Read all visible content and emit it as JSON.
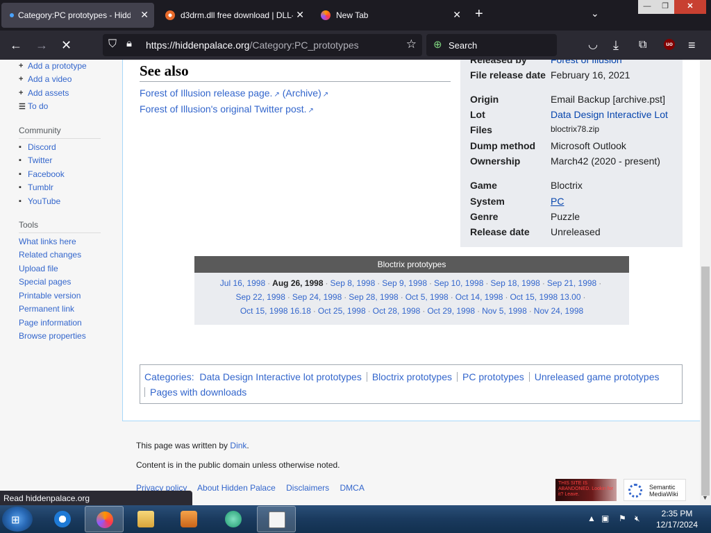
{
  "browser": {
    "tabs": [
      {
        "title": "Category:PC prototypes - Hidd",
        "active": true
      },
      {
        "title": "d3drm.dll free download | DLL-",
        "active": false
      },
      {
        "title": "New Tab",
        "active": false
      }
    ],
    "url_host": "https://hiddenpalace.org",
    "url_path": "/Category:PC_prototypes",
    "search_placeholder": "Search",
    "ublock_label": "uo",
    "status_text": "Read hiddenpalace.org"
  },
  "sidebar": {
    "actions": [
      {
        "icon": "+",
        "label": "Add a prototype"
      },
      {
        "icon": "+",
        "label": "Add a video"
      },
      {
        "icon": "+",
        "label": "Add assets"
      },
      {
        "icon": "☰",
        "label": "To do"
      }
    ],
    "community_heading": "Community",
    "community": [
      {
        "icon": "▪",
        "label": "Discord"
      },
      {
        "icon": "▪",
        "label": "Twitter"
      },
      {
        "icon": "▪",
        "label": "Facebook"
      },
      {
        "icon": "▪",
        "label": "Tumblr"
      },
      {
        "icon": "▪",
        "label": "YouTube"
      }
    ],
    "tools_heading": "Tools",
    "tools": [
      "What links here",
      "Related changes",
      "Upload file",
      "Special pages",
      "Printable version",
      "Permanent link",
      "Page information",
      "Browse properties"
    ]
  },
  "see_also": {
    "heading": "See also",
    "line1_link": "Forest of Illusion release page.",
    "line1_archive": "(Archive)",
    "line2_link": "Forest of Illusion's original Twitter post."
  },
  "infobox": {
    "rows": [
      {
        "key": "Released by",
        "value": "Forest of Illusion"
      },
      {
        "key": "File release date",
        "value": "February 16, 2021"
      },
      {
        "key": "Origin",
        "value": "Email Backup [archive.pst]"
      },
      {
        "key": "Lot",
        "value": "Data Design Interactive Lot"
      },
      {
        "key": "Files",
        "value": "bloctrix78.zip"
      },
      {
        "key": "Dump method",
        "value": "Microsoft Outlook"
      },
      {
        "key": "Ownership",
        "value": "March42 (2020 - present)"
      },
      {
        "key": "Game",
        "value": "Bloctrix"
      },
      {
        "key": "System",
        "value": "PC"
      },
      {
        "key": "Genre",
        "value": "Puzzle"
      },
      {
        "key": "Release date",
        "value": "Unreleased"
      }
    ]
  },
  "navbox": {
    "title": "Bloctrix prototypes",
    "line1": [
      "Jul 16, 1998",
      "Aug 26, 1998",
      "Sep 8, 1998",
      "Sep 9, 1998",
      "Sep 10, 1998",
      "Sep 18, 1998",
      "Sep 21, 1998"
    ],
    "line2": [
      "Sep 22, 1998",
      "Sep 24, 1998",
      "Sep 28, 1998",
      "Oct 5, 1998",
      "Oct 14, 1998",
      "Oct 15, 1998 13.00"
    ],
    "line3": [
      "Oct 15, 1998 16.18",
      "Oct 25, 1998",
      "Oct 28, 1998",
      "Oct 29, 1998",
      "Nov 5, 1998",
      "Nov 24, 1998"
    ],
    "current": "Aug 26, 1998"
  },
  "categories": {
    "label": "Categories",
    "items": [
      "Data Design Interactive lot prototypes",
      "Bloctrix prototypes",
      "PC prototypes",
      "Unreleased game prototypes",
      "Pages with downloads"
    ]
  },
  "footer": {
    "written_prefix": "This page was written by",
    "written_by": "Dink",
    "license": "Content is in the public domain unless otherwise noted.",
    "links": [
      "Privacy policy",
      "About Hidden Palace",
      "Disclaimers",
      "DMCA"
    ],
    "badge_hp": "THIS SITE IS ABANDONED. Lookin for it? Leave.",
    "badge_smw": "Semantic MediaWiki"
  },
  "taskbar": {
    "time": "2:35 PM",
    "date": "12/17/2024"
  }
}
